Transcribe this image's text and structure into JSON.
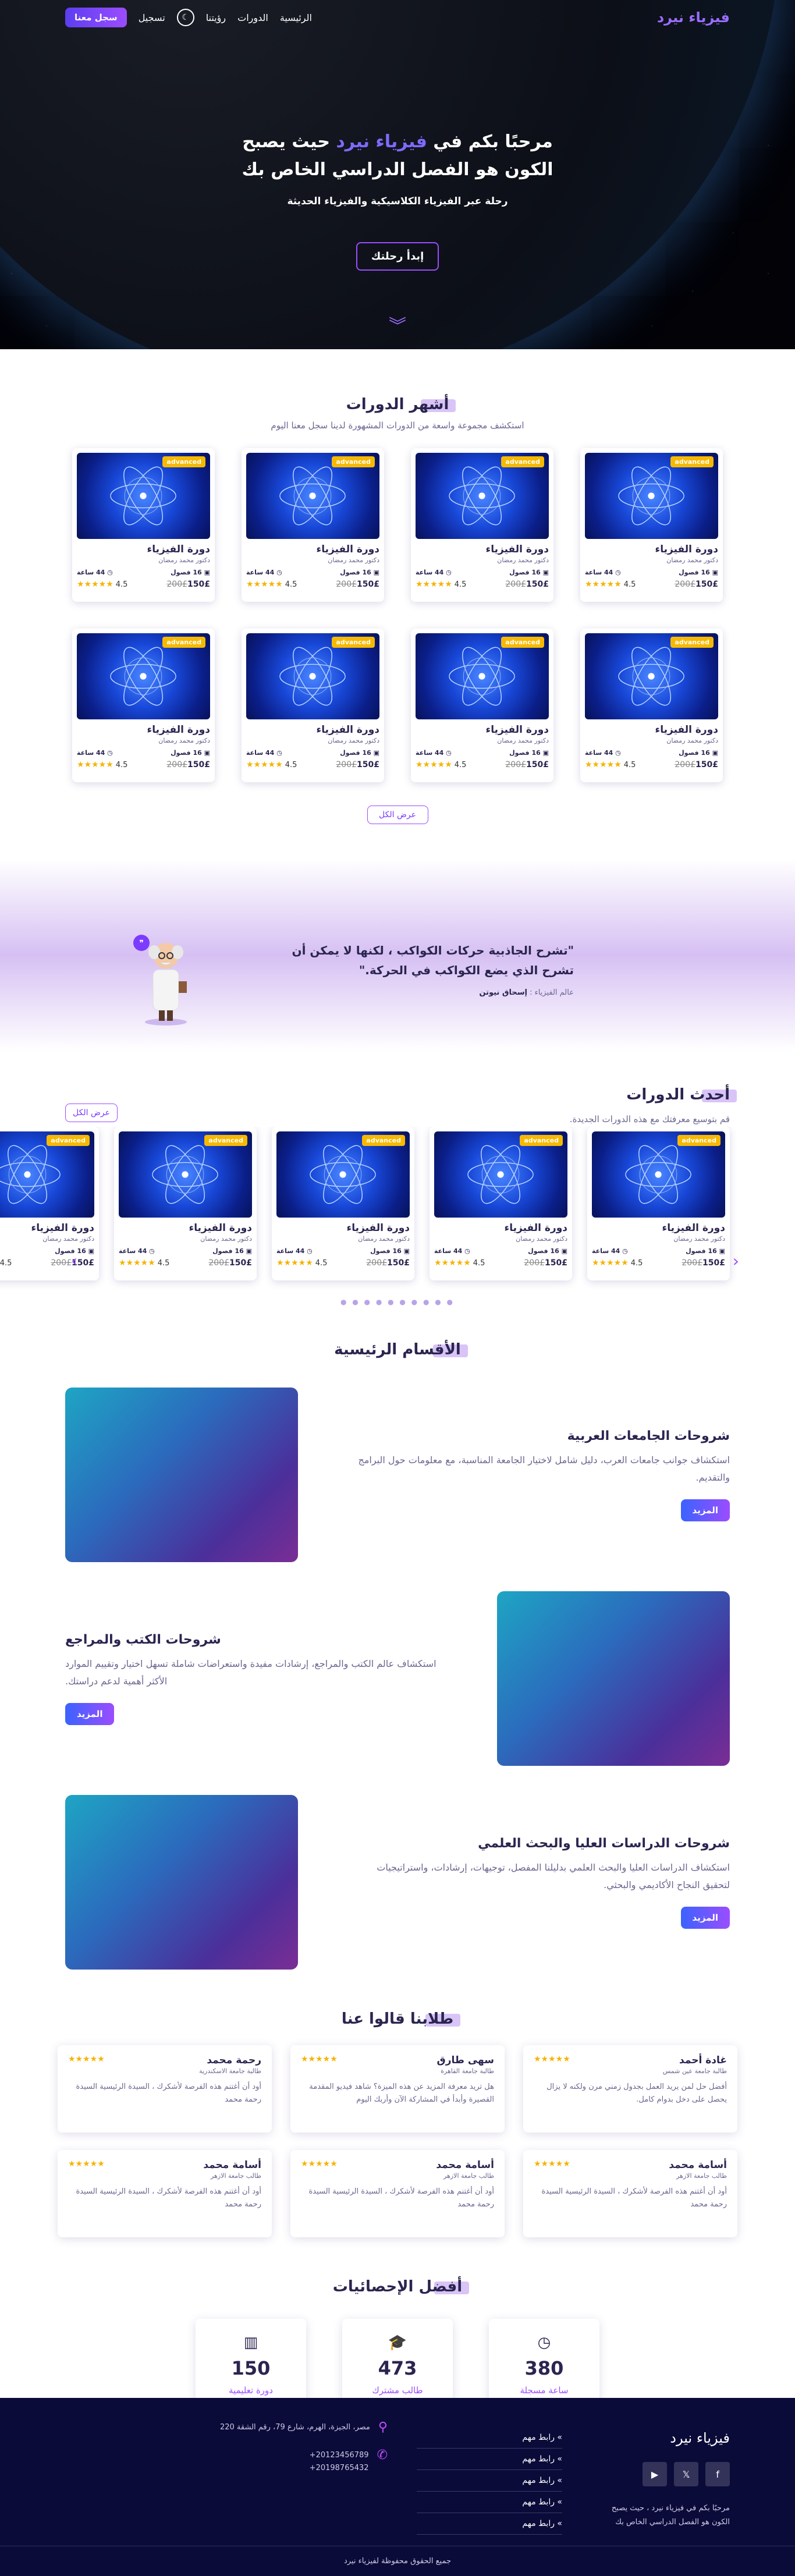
{
  "nav": {
    "logo": "فيزياء نيرد",
    "links": [
      "الرئيسية",
      "الدورات",
      "رؤيتنا"
    ],
    "login": "تسجيل",
    "signup": "سجل معنا"
  },
  "hero": {
    "title_pre": "مرحبًا بكم في",
    "title_hl": "فيزياء نيرد",
    "title_post": "حيث يصبح الكون هو الفصل الدراسي الخاص بك",
    "subtitle": "رحلة عبر الفيزياء الكلاسيكية والفيزياء الحديثة",
    "cta": "إبدأ رحلتك"
  },
  "popular": {
    "title": "أشهر الدورات",
    "subtitle": "استكشف مجموعة واسعة من الدورات المشهورة لدينا سجل معنا اليوم",
    "show_all": "عرض الكل"
  },
  "course": {
    "badge": "advanced",
    "title": "دورة الفيزياء",
    "author": "دكتور محمد رمضان",
    "chapters": "16 فصول",
    "hours": "44 ساعة",
    "price": "150£",
    "old_price": "200£",
    "rating": "4.5"
  },
  "quote": {
    "text": "\"تشرح الجاذبية حركات الكواكب ، لكنها لا يمكن أن تشرح الذي يضع الكواكب في الحركة.\"",
    "author_prefix": "عالم الفيزياء :",
    "author": "إسحاق نيوتن"
  },
  "latest": {
    "title": "أحدث الدورات",
    "subtitle": "قم بتوسيع معرفتك مع هذه الدورات الجديدة.",
    "show_all": "عرض الكل"
  },
  "departments": {
    "title": "الأقسام الرئيسية",
    "more": "المزيد",
    "items": [
      {
        "title": "شروحات الجامعات العربية",
        "desc": "استكشاف جوانب جامعات العرب، دليل شامل لاختيار الجامعة المناسبة، مع معلومات حول البرامج والتقديم."
      },
      {
        "title": "شروحات الكتب والمراجع",
        "desc": "استكشاف عالم الكتب والمراجع، إرشادات مفيدة واستعراضات شاملة تسهل اختيار وتقييم الموارد الأكثر أهمية لدعم دراستك."
      },
      {
        "title": "شروحات الدراسات العليا والبحث العلمي",
        "desc": "استكشاف الدراسات العليا والبحث العلمي بدليلنا المفصل، توجيهات، إرشادات، واستراتيجيات لتحقيق النجاح الأكاديمي والبحثي."
      }
    ]
  },
  "testimonials": {
    "title": "طلابنا قالوا عنا",
    "items": [
      {
        "name": "غادة أحمد",
        "uni": "طالبة جامعة عين شمس",
        "text": "أفضل حل لمن يريد العمل بجدول زمني مرن ولكنه لا يزال يحصل على دخل بدوام كامل."
      },
      {
        "name": "سهى طارق",
        "uni": "طالبة جامعة القاهرة",
        "text": "هل تريد معرفة المزيد عن هذه الميزة؟ شاهد فيديو المقدمة القصيرة وأبدأ في المشاركة الآن وأربك اليوم"
      },
      {
        "name": "رحمة محمد",
        "uni": "طالبة جامعة الاسكندرية",
        "text": "أود أن أغتنم هذه الفرصة لأشكرك ، السيدة الرئيسية السيدة رحمة محمد"
      },
      {
        "name": "أسامة محمد",
        "uni": "طالب جامعة الازهر",
        "text": "أود أن أغتنم هذه الفرصة لأشكرك ، السيدة الرئيسية السيدة رحمة محمد"
      },
      {
        "name": "أسامة محمد",
        "uni": "طالب جامعة الازهر",
        "text": "أود أن أغتنم هذه الفرصة لأشكرك ، السيدة الرئيسية السيدة رحمة محمد"
      },
      {
        "name": "أسامة محمد",
        "uni": "طالب جامعة الازهر",
        "text": "أود أن أغتنم هذه الفرصة لأشكرك ، السيدة الرئيسية السيدة رحمة محمد"
      }
    ]
  },
  "stats": {
    "title": "أفضل الإحصائيات",
    "items": [
      {
        "num": "380",
        "label": "ساعة مسجلة",
        "icon": "clock-icon"
      },
      {
        "num": "473",
        "label": "طالب مشترك",
        "icon": "graduation-icon"
      },
      {
        "num": "150",
        "label": "دورة تعليمية",
        "icon": "books-icon"
      }
    ]
  },
  "footer": {
    "logo": "فيزياء نيرد",
    "desc": "مرحبًا بكم في فيزياء نيرد ، حيث يصبح الكون هو الفصل الدراسي الخاص بك",
    "links": [
      "رابط مهم",
      "رابط مهم",
      "رابط مهم",
      "رابط مهم",
      "رابط مهم"
    ],
    "address": "مصر، الجيزة، الهرم، شارع 79، رقم الشقة 220",
    "phones": "20123456789+\n20198765432+",
    "copyright": "جميع الحقوق محفوظة لفيزياء نيرد"
  },
  "colors": {
    "accent": "#9b4dff",
    "dark": "#0b0b3a",
    "star": "#f5b301"
  }
}
